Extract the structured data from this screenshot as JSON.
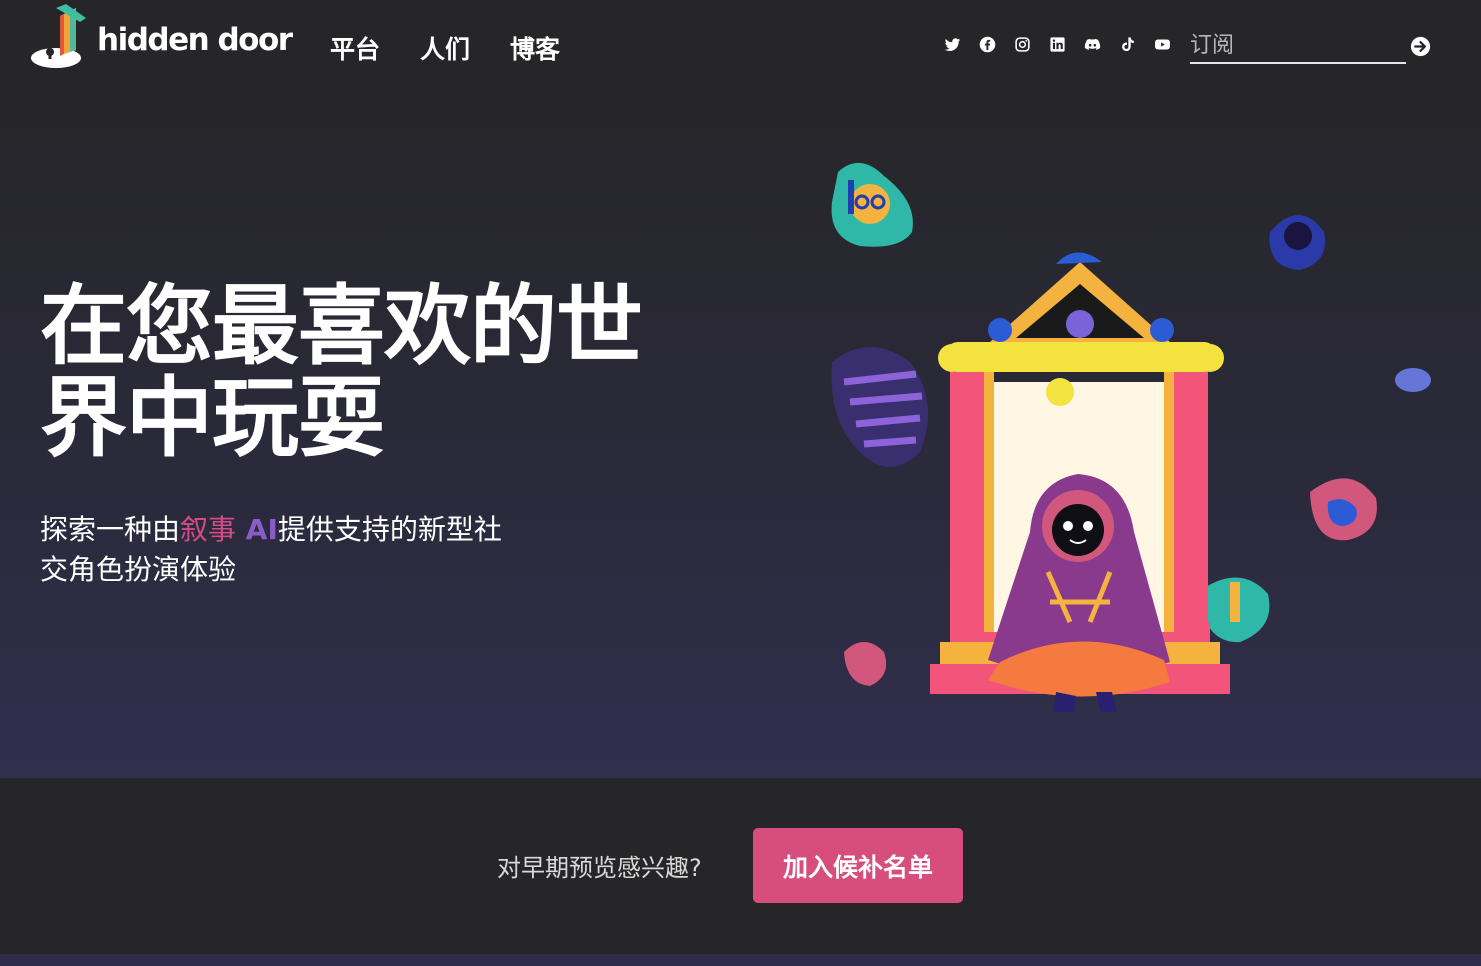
{
  "header": {
    "brand": "hidden door",
    "nav": [
      "平台",
      "人们",
      "博客"
    ],
    "socials": [
      "twitter-icon",
      "facebook-icon",
      "instagram-icon",
      "linkedin-icon",
      "discord-icon",
      "tiktok-icon",
      "youtube-icon"
    ],
    "subscribe_placeholder": "订阅"
  },
  "hero": {
    "title": "在您最喜欢的世界中玩耍",
    "subtitle_part1": "探索一种由",
    "subtitle_accent1": "叙事",
    "subtitle_accent2": " AI",
    "subtitle_part2": "提供支持的新型社交角色扮演体验"
  },
  "cta": {
    "text": "对早期预览感兴趣?",
    "button": "加入候补名单"
  },
  "colors": {
    "background": "#262629",
    "accent_pink": "#d74d7c",
    "accent_purple": "#8a5cc9"
  }
}
